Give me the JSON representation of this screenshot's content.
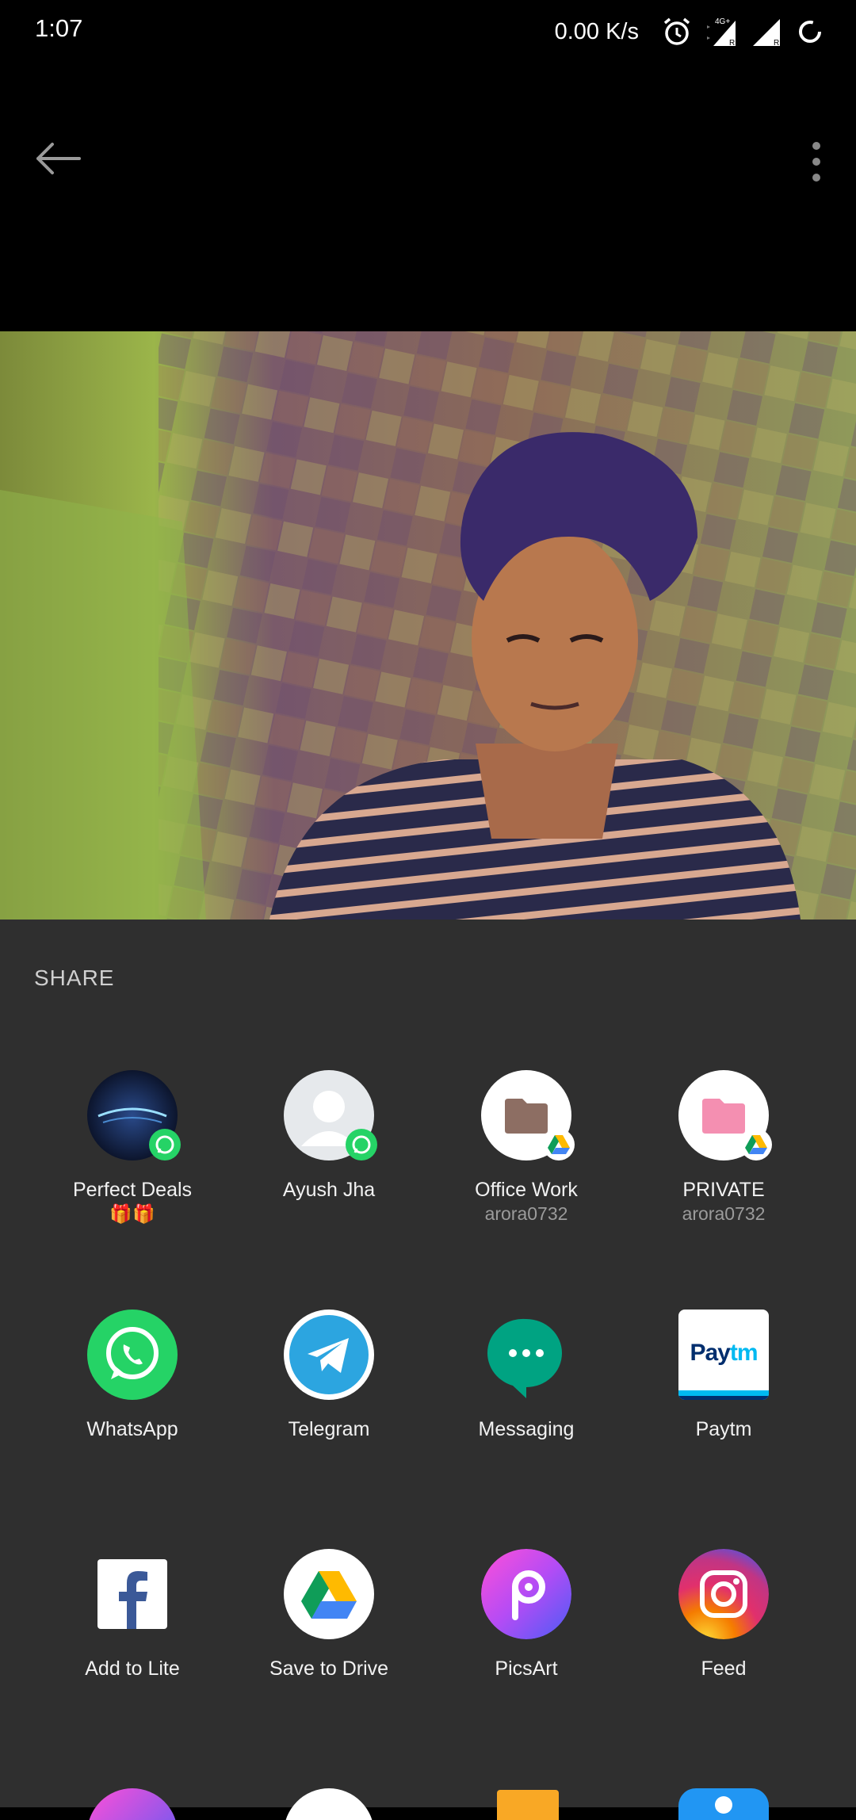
{
  "status_bar": {
    "time": "1:07",
    "net_speed": "0.00 K/s",
    "icons": [
      "alarm-icon",
      "signal-4g-icon",
      "signal-icon",
      "battery-ring-icon"
    ]
  },
  "app_bar": {
    "back_icon": "arrow-left-icon",
    "menu_icon": "more-vert-icon"
  },
  "share": {
    "title": "SHARE",
    "direct_targets": [
      {
        "label": "Perfect Deals",
        "emoji": "🎁🎁",
        "sub": "",
        "icon": "perfect-deals-avatar",
        "badge": "whatsapp-badge-icon"
      },
      {
        "label": "Ayush Jha",
        "sub": "",
        "icon": "person-avatar",
        "badge": "whatsapp-badge-icon"
      },
      {
        "label": "Office Work",
        "sub": "arora0732",
        "icon": "folder-brown-icon",
        "badge": "drive-badge-icon"
      },
      {
        "label": "PRIVATE",
        "sub": "arora0732",
        "icon": "folder-pink-icon",
        "badge": "drive-badge-icon"
      }
    ],
    "apps_row1": [
      {
        "label": "WhatsApp",
        "icon": "whatsapp-icon"
      },
      {
        "label": "Telegram",
        "icon": "telegram-icon"
      },
      {
        "label": "Messaging",
        "icon": "messaging-icon"
      },
      {
        "label": "Paytm",
        "icon": "paytm-icon",
        "logo_text": "Paytm"
      }
    ],
    "apps_row2": [
      {
        "label": "Add to Lite",
        "icon": "facebook-lite-icon"
      },
      {
        "label": "Save to Drive",
        "icon": "google-drive-icon"
      },
      {
        "label": "PicsArt",
        "icon": "picsart-icon"
      },
      {
        "label": "Feed",
        "icon": "instagram-icon"
      }
    ]
  },
  "colors": {
    "sheet_bg": "#2f2f2f",
    "whatsapp": "#25d366",
    "telegram": "#2ca5e0",
    "messaging": "#00a382",
    "paytm_navy": "#002e6e",
    "paytm_blue": "#00b9f1"
  }
}
